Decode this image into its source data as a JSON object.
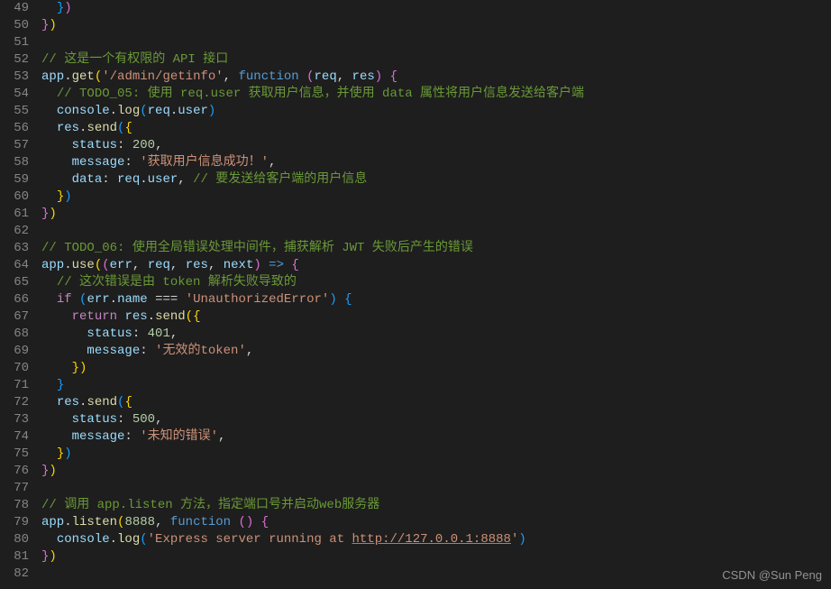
{
  "watermark": "CSDN @Sun  Peng",
  "lines": [
    {
      "n": "49",
      "indent": 1,
      "tokens": [
        [
          "br3",
          "}"
        ],
        [
          "br2",
          ")"
        ]
      ]
    },
    {
      "n": "50",
      "indent": 0,
      "tokens": [
        [
          "br2",
          "}"
        ],
        [
          "br1",
          ")"
        ]
      ]
    },
    {
      "n": "51",
      "indent": 0,
      "tokens": []
    },
    {
      "n": "52",
      "indent": 0,
      "tokens": [
        [
          "com",
          "// 这是一个有权限的 API 接口"
        ]
      ]
    },
    {
      "n": "53",
      "indent": 0,
      "tokens": [
        [
          "obj",
          "app"
        ],
        [
          "pn",
          "."
        ],
        [
          "fn",
          "get"
        ],
        [
          "br1",
          "("
        ],
        [
          "str",
          "'/admin/getinfo'"
        ],
        [
          "pn",
          ", "
        ],
        [
          "kw",
          "function"
        ],
        [
          "pn",
          " "
        ],
        [
          "br2",
          "("
        ],
        [
          "obj",
          "req"
        ],
        [
          "pn",
          ", "
        ],
        [
          "obj",
          "res"
        ],
        [
          "br2",
          ")"
        ],
        [
          "pn",
          " "
        ],
        [
          "br2",
          "{"
        ]
      ]
    },
    {
      "n": "54",
      "indent": 1,
      "tokens": [
        [
          "com",
          "// TODO_05: 使用 req.user 获取用户信息，并使用 data 属性将用户信息发送给客户端"
        ]
      ]
    },
    {
      "n": "55",
      "indent": 1,
      "tokens": [
        [
          "obj",
          "console"
        ],
        [
          "pn",
          "."
        ],
        [
          "fn",
          "log"
        ],
        [
          "br3",
          "("
        ],
        [
          "obj",
          "req"
        ],
        [
          "pn",
          "."
        ],
        [
          "obj",
          "user"
        ],
        [
          "br3",
          ")"
        ]
      ]
    },
    {
      "n": "56",
      "indent": 1,
      "tokens": [
        [
          "obj",
          "res"
        ],
        [
          "pn",
          "."
        ],
        [
          "fn",
          "send"
        ],
        [
          "br3",
          "("
        ],
        [
          "br4",
          "{"
        ]
      ]
    },
    {
      "n": "57",
      "indent": 2,
      "tokens": [
        [
          "obj",
          "status"
        ],
        [
          "pn",
          ": "
        ],
        [
          "num",
          "200"
        ],
        [
          "pn",
          ","
        ]
      ]
    },
    {
      "n": "58",
      "indent": 2,
      "tokens": [
        [
          "obj",
          "message"
        ],
        [
          "pn",
          ": "
        ],
        [
          "str",
          "'获取用户信息成功！'"
        ],
        [
          "pn",
          ","
        ]
      ]
    },
    {
      "n": "59",
      "indent": 2,
      "tokens": [
        [
          "obj",
          "data"
        ],
        [
          "pn",
          ": "
        ],
        [
          "obj",
          "req"
        ],
        [
          "pn",
          "."
        ],
        [
          "obj",
          "user"
        ],
        [
          "pn",
          ", "
        ],
        [
          "com",
          "// 要发送给客户端的用户信息"
        ]
      ]
    },
    {
      "n": "60",
      "indent": 1,
      "tokens": [
        [
          "br4",
          "}"
        ],
        [
          "br3",
          ")"
        ]
      ]
    },
    {
      "n": "61",
      "indent": 0,
      "tokens": [
        [
          "br2",
          "}"
        ],
        [
          "br1",
          ")"
        ]
      ]
    },
    {
      "n": "62",
      "indent": 0,
      "tokens": []
    },
    {
      "n": "63",
      "indent": 0,
      "tokens": [
        [
          "com",
          "// TODO_06: 使用全局错误处理中间件，捕获解析 JWT 失败后产生的错误"
        ]
      ]
    },
    {
      "n": "64",
      "indent": 0,
      "tokens": [
        [
          "obj",
          "app"
        ],
        [
          "pn",
          "."
        ],
        [
          "fn",
          "use"
        ],
        [
          "br1",
          "("
        ],
        [
          "br2",
          "("
        ],
        [
          "obj",
          "err"
        ],
        [
          "pn",
          ", "
        ],
        [
          "obj",
          "req"
        ],
        [
          "pn",
          ", "
        ],
        [
          "obj",
          "res"
        ],
        [
          "pn",
          ", "
        ],
        [
          "obj",
          "next"
        ],
        [
          "br2",
          ")"
        ],
        [
          "pn",
          " "
        ],
        [
          "kw",
          "=>"
        ],
        [
          "pn",
          " "
        ],
        [
          "br2",
          "{"
        ]
      ]
    },
    {
      "n": "65",
      "indent": 1,
      "tokens": [
        [
          "com",
          "// 这次错误是由 token 解析失败导致的"
        ]
      ]
    },
    {
      "n": "66",
      "indent": 1,
      "tokens": [
        [
          "kw2",
          "if"
        ],
        [
          "pn",
          " "
        ],
        [
          "br3",
          "("
        ],
        [
          "obj",
          "err"
        ],
        [
          "pn",
          "."
        ],
        [
          "obj",
          "name"
        ],
        [
          "pn",
          " === "
        ],
        [
          "str",
          "'UnauthorizedError'"
        ],
        [
          "br3",
          ")"
        ],
        [
          "pn",
          " "
        ],
        [
          "br3",
          "{"
        ]
      ]
    },
    {
      "n": "67",
      "indent": 2,
      "tokens": [
        [
          "kw2",
          "return"
        ],
        [
          "pn",
          " "
        ],
        [
          "obj",
          "res"
        ],
        [
          "pn",
          "."
        ],
        [
          "fn",
          "send"
        ],
        [
          "br4",
          "("
        ],
        [
          "br1",
          "{"
        ]
      ]
    },
    {
      "n": "68",
      "indent": 3,
      "tokens": [
        [
          "obj",
          "status"
        ],
        [
          "pn",
          ": "
        ],
        [
          "num",
          "401"
        ],
        [
          "pn",
          ","
        ]
      ]
    },
    {
      "n": "69",
      "indent": 3,
      "tokens": [
        [
          "obj",
          "message"
        ],
        [
          "pn",
          ": "
        ],
        [
          "str",
          "'无效的token'"
        ],
        [
          "pn",
          ","
        ]
      ]
    },
    {
      "n": "70",
      "indent": 2,
      "tokens": [
        [
          "br1",
          "}"
        ],
        [
          "br4",
          ")"
        ]
      ]
    },
    {
      "n": "71",
      "indent": 1,
      "tokens": [
        [
          "br3",
          "}"
        ]
      ]
    },
    {
      "n": "72",
      "indent": 1,
      "tokens": [
        [
          "obj",
          "res"
        ],
        [
          "pn",
          "."
        ],
        [
          "fn",
          "send"
        ],
        [
          "br3",
          "("
        ],
        [
          "br4",
          "{"
        ]
      ]
    },
    {
      "n": "73",
      "indent": 2,
      "tokens": [
        [
          "obj",
          "status"
        ],
        [
          "pn",
          ": "
        ],
        [
          "num",
          "500"
        ],
        [
          "pn",
          ","
        ]
      ]
    },
    {
      "n": "74",
      "indent": 2,
      "tokens": [
        [
          "obj",
          "message"
        ],
        [
          "pn",
          ": "
        ],
        [
          "str",
          "'未知的错误'"
        ],
        [
          "pn",
          ","
        ]
      ]
    },
    {
      "n": "75",
      "indent": 1,
      "tokens": [
        [
          "br4",
          "}"
        ],
        [
          "br3",
          ")"
        ]
      ]
    },
    {
      "n": "76",
      "indent": 0,
      "tokens": [
        [
          "br2",
          "}"
        ],
        [
          "br1",
          ")"
        ]
      ]
    },
    {
      "n": "77",
      "indent": 0,
      "tokens": []
    },
    {
      "n": "78",
      "indent": 0,
      "tokens": [
        [
          "com",
          "// 调用 app.listen 方法，指定端口号并启动web服务器"
        ]
      ]
    },
    {
      "n": "79",
      "indent": 0,
      "tokens": [
        [
          "obj",
          "app"
        ],
        [
          "pn",
          "."
        ],
        [
          "fn",
          "listen"
        ],
        [
          "br1",
          "("
        ],
        [
          "num",
          "8888"
        ],
        [
          "pn",
          ", "
        ],
        [
          "kw",
          "function"
        ],
        [
          "pn",
          " "
        ],
        [
          "br2",
          "()"
        ],
        [
          "pn",
          " "
        ],
        [
          "br2",
          "{"
        ]
      ]
    },
    {
      "n": "80",
      "indent": 1,
      "tokens": [
        [
          "obj",
          "console"
        ],
        [
          "pn",
          "."
        ],
        [
          "fn",
          "log"
        ],
        [
          "br3",
          "("
        ],
        [
          "str",
          "'Express server running at "
        ],
        [
          "url",
          "http://127.0.0.1:8888"
        ],
        [
          "str",
          "'"
        ],
        [
          "br3",
          ")"
        ]
      ]
    },
    {
      "n": "81",
      "indent": 0,
      "tokens": [
        [
          "br2",
          "}"
        ],
        [
          "br1",
          ")"
        ]
      ]
    },
    {
      "n": "82",
      "indent": 0,
      "tokens": []
    }
  ]
}
